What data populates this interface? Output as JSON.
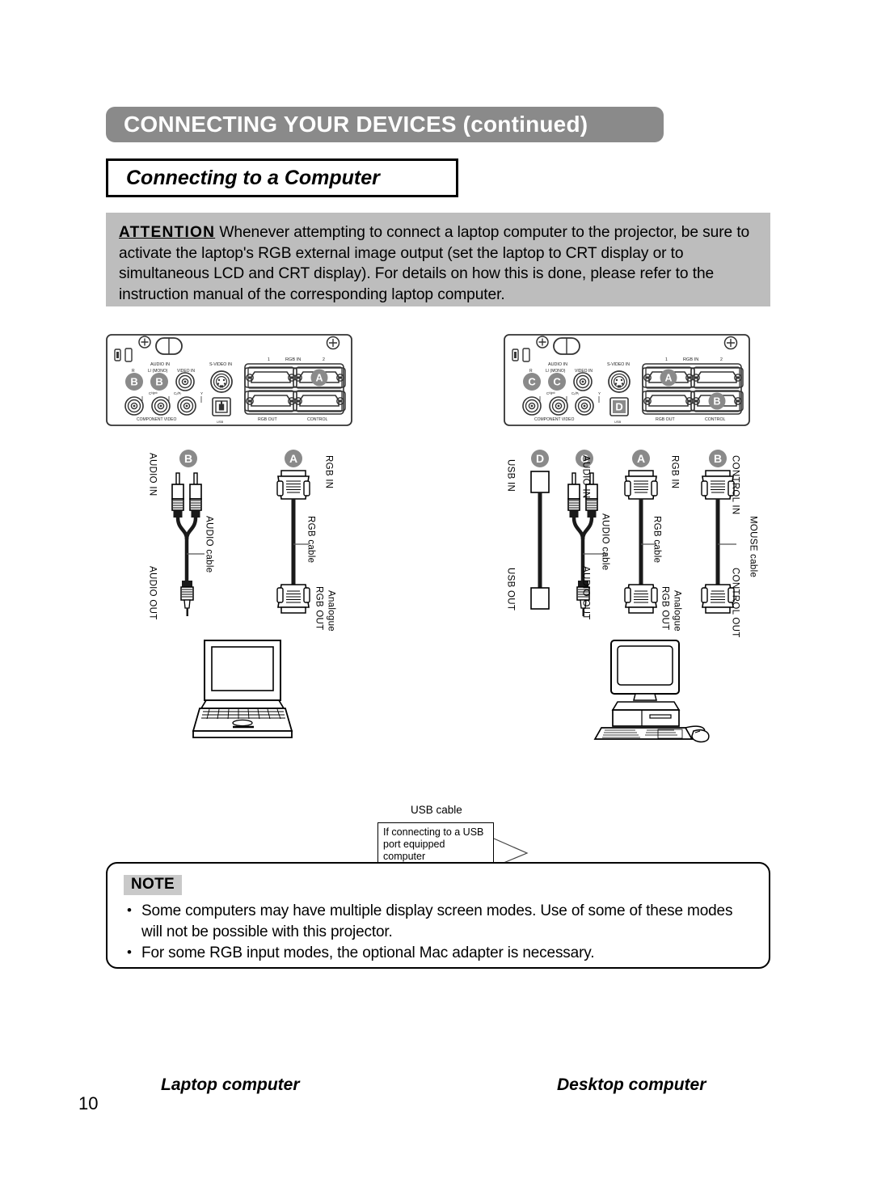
{
  "header": {
    "title": "CONNECTING YOUR DEVICES (continued)",
    "subtitle": "Connecting to a Computer",
    "bar_color": "#8a8a8a"
  },
  "attention": {
    "keyword": "ATTENTION",
    "body": " Whenever attempting to connect a laptop computer to the projector, be sure to activate the laptop's RGB external image output (set the laptop to CRT display or to simultaneous LCD and CRT display). For details on how this is done, please refer to the instruction manual of the corresponding laptop computer.",
    "background": "#bdbdbd"
  },
  "panel": {
    "audio_in": "AUDIO IN",
    "audio_r": "R",
    "audio_l_mono": "L/ (MONO)",
    "video_in": "VIDEO IN",
    "svideo_in": "S-VIDEO IN",
    "cb_pb": "CB/PB",
    "cr_pr": "CR/PR",
    "y": "Y",
    "component_video": "COMPONENT  VIDEO",
    "usb": "USB",
    "rgb_in": "RGB  IN",
    "rgb_in_1": "1",
    "rgb_in_2": "2",
    "rgb_out": "RGB  OUT",
    "control": "CONTROL",
    "left_markers": {
      "audio_r": "B",
      "audio_l": "B",
      "rgb_in_2": "A"
    },
    "right_markers": {
      "audio_r": "C",
      "audio_l": "C",
      "usb": "D",
      "rgb_in_1": "A",
      "control": "B"
    }
  },
  "laptop_section": {
    "caption": "Laptop computer",
    "cables": [
      {
        "marker": "B",
        "name": "AUDIO cable",
        "top_label": "AUDIO IN",
        "bottom_label": "AUDIO OUT",
        "type": "rca-to-mini"
      },
      {
        "marker": "A",
        "name": "RGB cable",
        "top_label": "RGB IN",
        "bottom_label_1": "Analogue",
        "bottom_label_2": "RGB OUT",
        "type": "dsub"
      }
    ]
  },
  "desktop_section": {
    "caption": "Desktop computer",
    "cables": [
      {
        "marker": "D",
        "name": "USB cable",
        "top_label": "USB IN",
        "bottom_label": "USB OUT",
        "type": "usb"
      },
      {
        "marker": "C",
        "name": "AUDIO cable",
        "top_label": "AUDIO IN",
        "bottom_label": "AUDIO OUT",
        "type": "rca-to-mini"
      },
      {
        "marker": "A",
        "name": "RGB cable",
        "top_label": "RGB IN",
        "bottom_label_1": "Analogue",
        "bottom_label_2": "RGB OUT",
        "type": "dsub"
      },
      {
        "marker": "B",
        "name": "MOUSE cable",
        "top_label": "CONTROL IN",
        "bottom_label": "CONTROL OUT",
        "type": "dsub"
      }
    ]
  },
  "callout": {
    "title": "USB cable",
    "text": "If connecting to a USB port equipped computer"
  },
  "note": {
    "badge": "NOTE",
    "items": [
      "Some computers may have multiple display screen modes. Use of some of these modes will not be possible with this projector.",
      "For some RGB input modes, the optional Mac adapter is necessary."
    ]
  },
  "footer": {
    "page_number": "10"
  }
}
